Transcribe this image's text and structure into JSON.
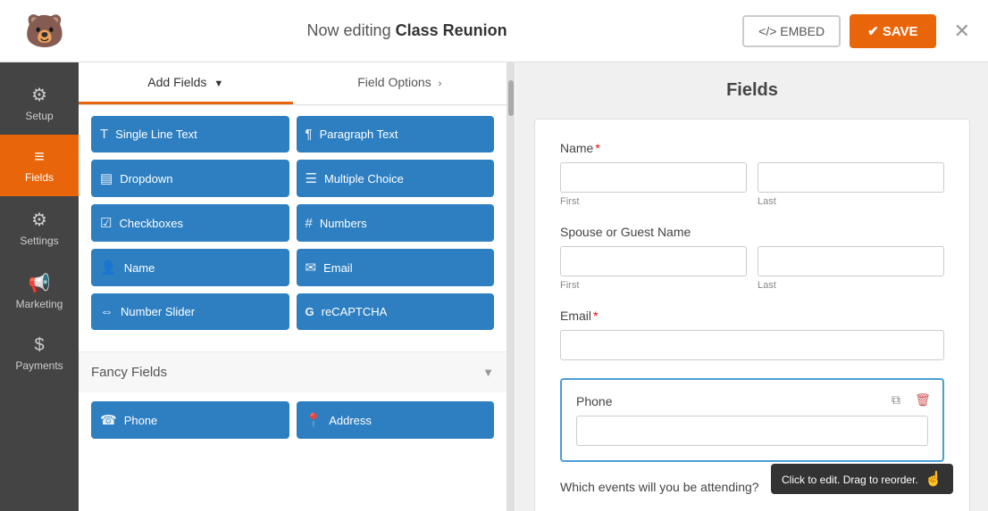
{
  "topbar": {
    "editing_prefix": "Now editing ",
    "form_name": "Class Reunion",
    "embed_label": "</> EMBED",
    "save_label": "✔ SAVE",
    "close_icon": "✕"
  },
  "sidebar": {
    "items": [
      {
        "id": "setup",
        "label": "Setup",
        "icon": "⚙"
      },
      {
        "id": "fields",
        "label": "Fields",
        "icon": "≡",
        "active": true
      },
      {
        "id": "settings",
        "label": "Settings",
        "icon": "⚙"
      },
      {
        "id": "marketing",
        "label": "Marketing",
        "icon": "📢"
      },
      {
        "id": "payments",
        "label": "Payments",
        "icon": "$"
      }
    ]
  },
  "fields_panel": {
    "add_fields_tab": "Add Fields",
    "field_options_tab": "Field Options",
    "field_buttons": [
      {
        "id": "single-line",
        "icon": "T",
        "label": "Single Line Text"
      },
      {
        "id": "paragraph",
        "icon": "¶",
        "label": "Paragraph Text"
      },
      {
        "id": "dropdown",
        "icon": "▤",
        "label": "Dropdown"
      },
      {
        "id": "multiple-choice",
        "icon": "☰",
        "label": "Multiple Choice"
      },
      {
        "id": "checkboxes",
        "icon": "☑",
        "label": "Checkboxes"
      },
      {
        "id": "numbers",
        "icon": "#",
        "label": "Numbers"
      },
      {
        "id": "name",
        "icon": "👤",
        "label": "Name"
      },
      {
        "id": "email",
        "icon": "✉",
        "label": "Email"
      },
      {
        "id": "number-slider",
        "icon": "⇔",
        "label": "Number Slider"
      },
      {
        "id": "recaptcha",
        "icon": "G",
        "label": "reCAPTCHA"
      }
    ],
    "fancy_fields_label": "Fancy Fields",
    "fancy_fields_buttons": [
      {
        "id": "phone",
        "icon": "☎",
        "label": "Phone"
      },
      {
        "id": "address",
        "icon": "📍",
        "label": "Address"
      }
    ]
  },
  "form_preview": {
    "section_title": "Fields",
    "fields": [
      {
        "id": "name",
        "label": "Name",
        "required": true,
        "type": "name",
        "cols": [
          {
            "placeholder": "",
            "sub_label": "First"
          },
          {
            "placeholder": "",
            "sub_label": "Last"
          }
        ]
      },
      {
        "id": "spouse-guest",
        "label": "Spouse or Guest Name",
        "required": false,
        "type": "name",
        "cols": [
          {
            "placeholder": "",
            "sub_label": "First"
          },
          {
            "placeholder": "",
            "sub_label": "Last"
          }
        ]
      },
      {
        "id": "email",
        "label": "Email",
        "required": true,
        "type": "email"
      },
      {
        "id": "phone",
        "label": "Phone",
        "required": false,
        "type": "phone",
        "tooltip": "Click to edit. Drag to reorder."
      },
      {
        "id": "which-events",
        "label": "Which events will you be attending?",
        "required": false
      }
    ]
  }
}
